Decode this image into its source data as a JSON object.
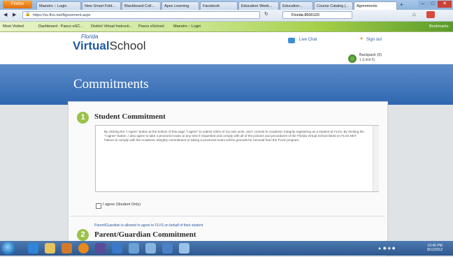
{
  "browser": {
    "app_button": "Firefox",
    "tabs": [
      {
        "label": "Maestro :: Login"
      },
      {
        "label": "New Smart Fold..."
      },
      {
        "label": "Blackboard Coll..."
      },
      {
        "label": "Apex Learning"
      },
      {
        "label": "Facebook"
      },
      {
        "label": "Education Week..."
      },
      {
        "label": "Education..."
      },
      {
        "label": "Course Catalog |..."
      },
      {
        "label": "Agreements"
      }
    ],
    "url": "https://vs.flvs.net/Agreement.aspx",
    "search": "Florida 8500120",
    "bookmarks": [
      "Most Visited",
      "Dashboard - Pasco eSC...",
      "District Virtual Instructi...",
      "Pasco eSchool",
      "Maestro :: Login"
    ],
    "bookmarks_right": "Bookmarks"
  },
  "header": {
    "logo_top": "Florida",
    "logo_virtual": "Virtual",
    "logo_school": "School",
    "live_chat": "Live Chat",
    "sign_out": "Sign out",
    "backpack_title": "Backpack",
    "backpack_count": "(0)",
    "backpack_sub": "1 (Limit 5)"
  },
  "page": {
    "title": "Commitments",
    "student": {
      "number": "1",
      "title": "Student Commitment",
      "body": "By clicking the \"I Agree\" button at the bottom of this page \"I agree\" to submit 100% of my own work, and I commit to Academic Integrity registering as a student at FLVS. By clicking the \"I agree\" button, I also agree to take a proctored exam at any time if requested and comply with all of the policies and procedures of the Florida Virtual School listed on FLVS.NET. Failure to comply with the Academic Integrity commitment or taking a proctored exam will be grounds for removal from the FLVS program.",
      "agree_label": "I agree (Student Only)"
    },
    "parent": {
      "notice": "Parent/Guardian is allowed to agree to FLVS on behalf of their student",
      "number": "2",
      "title": "Parent/Guardian Commitment"
    }
  },
  "taskbar": {
    "time": "10:46 PM",
    "date": "8/12/2012"
  },
  "colors": {
    "banner": "#3a72b8",
    "accent_green": "#9bc24a",
    "link_blue": "#2a5aa5"
  }
}
